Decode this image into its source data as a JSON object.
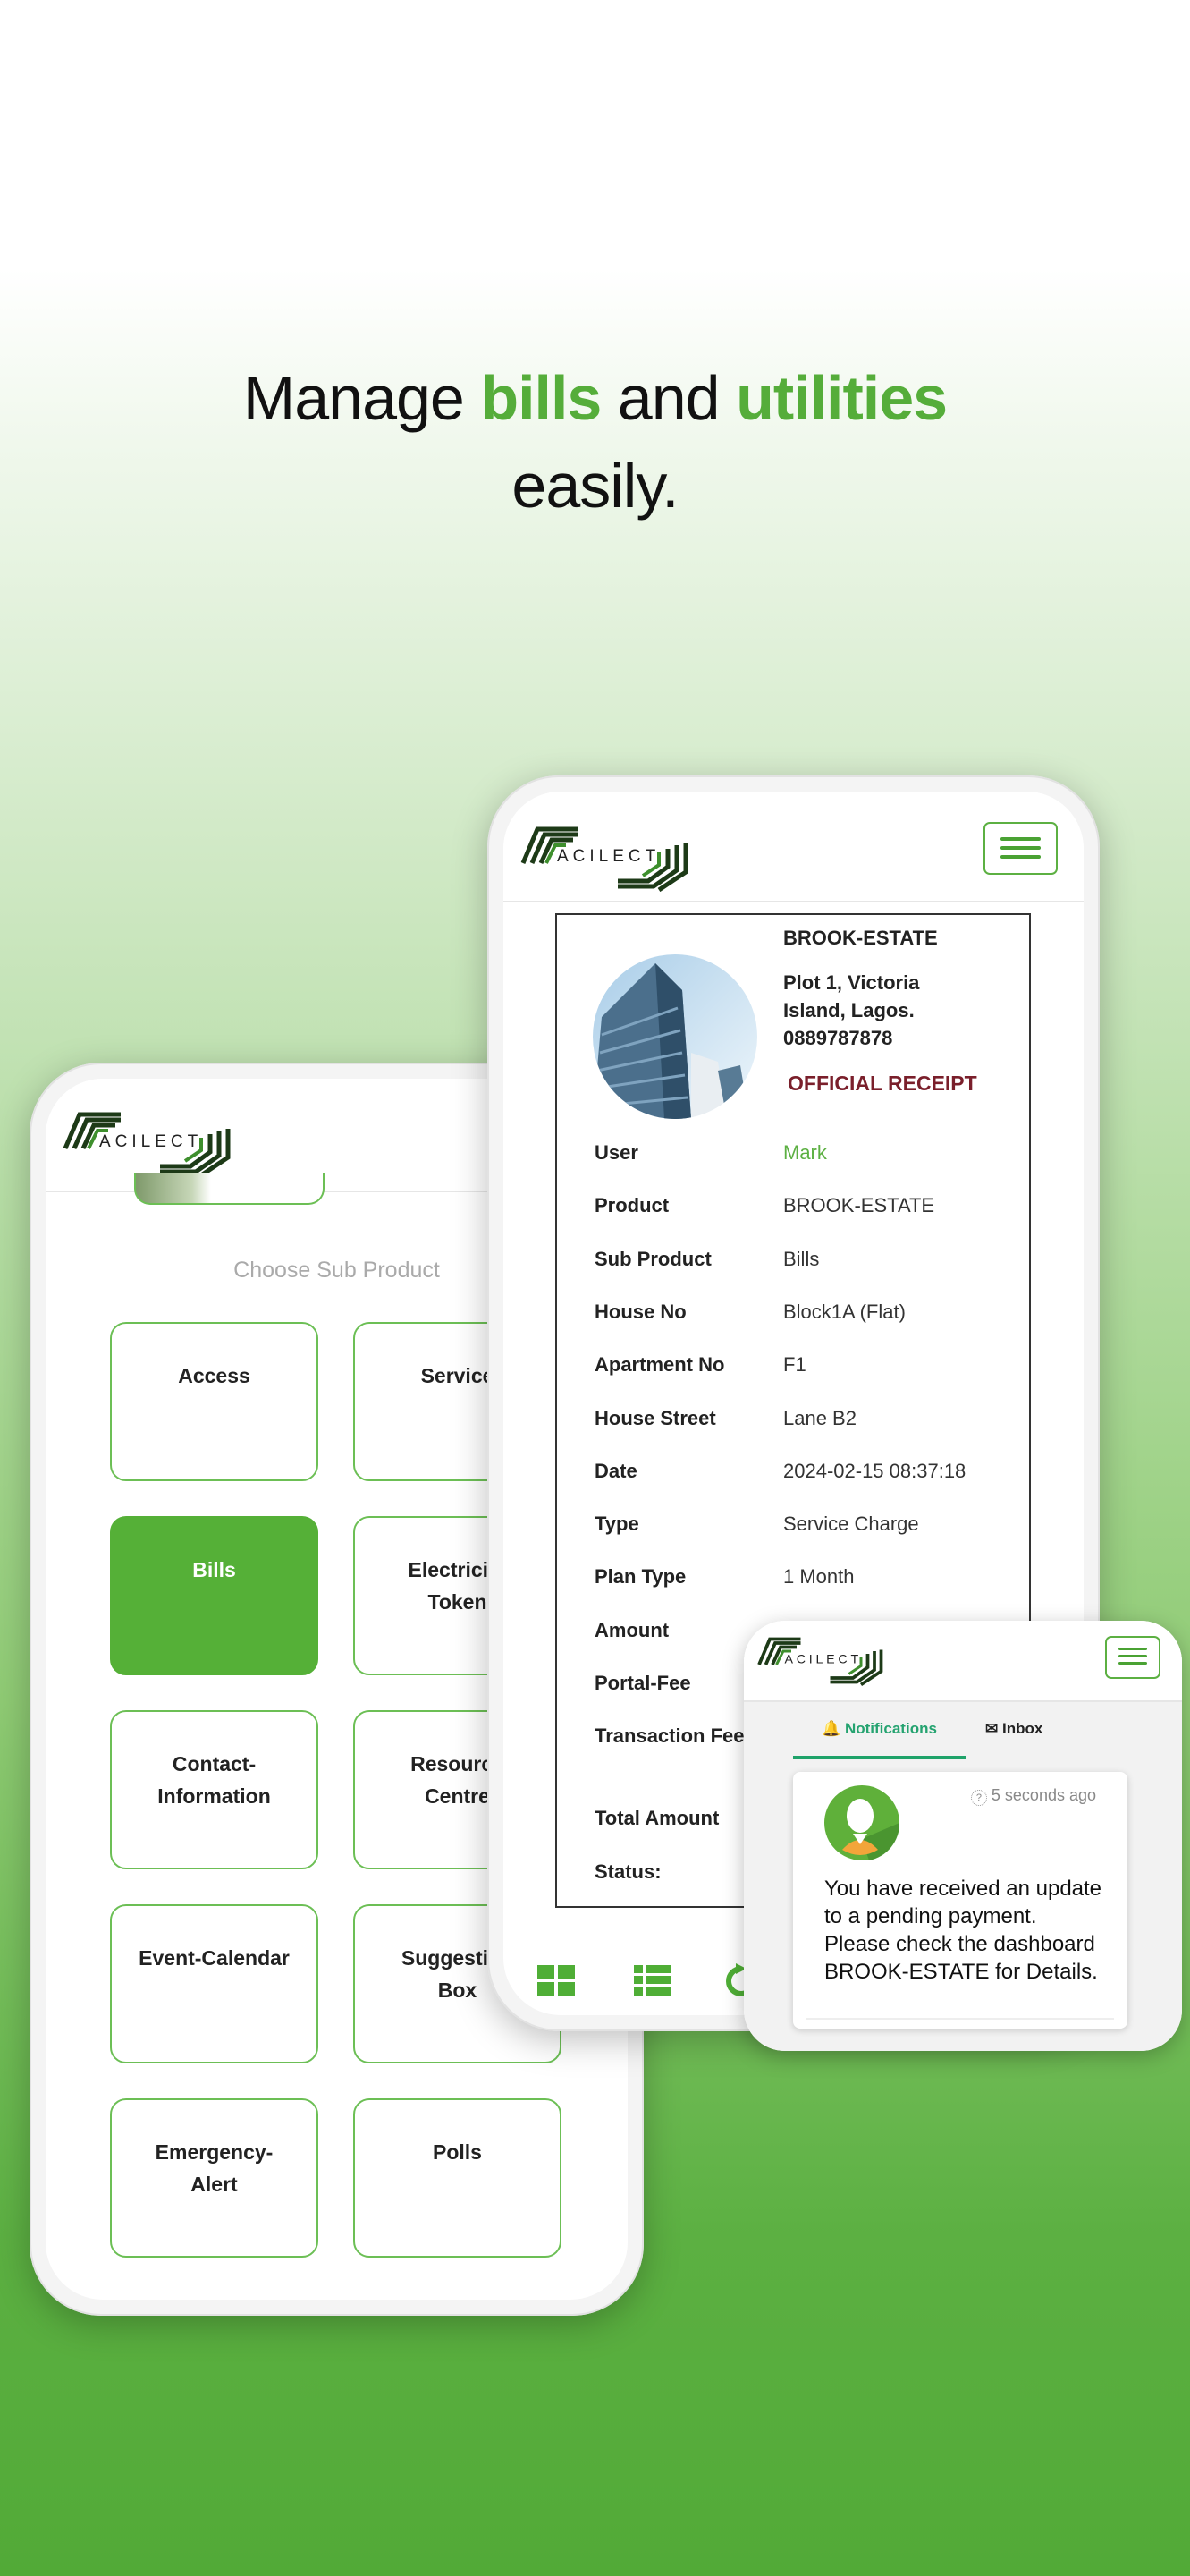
{
  "headline": {
    "part1": "Manage ",
    "highlight1": "bills",
    "part2": " and ",
    "highlight2": "utilities",
    "line2": "easily."
  },
  "brand": {
    "logo_text": "ACILECT",
    "accent_color": "#55ad3a",
    "receipt_title_color": "#7a1f2b"
  },
  "left_phone": {
    "section_title": "Choose Sub Product",
    "tiles": [
      {
        "label": "Access",
        "active": false
      },
      {
        "label": "Service",
        "active": false
      },
      {
        "label": "Bills",
        "active": true
      },
      {
        "label": "Electricity Token",
        "active": false
      },
      {
        "label": "Contact-Information",
        "active": false
      },
      {
        "label": "Resource Centre",
        "active": false
      },
      {
        "label": "Event-Calendar",
        "active": false
      },
      {
        "label": "Suggestion Box",
        "active": false
      },
      {
        "label": "Emergency-Alert",
        "active": false
      },
      {
        "label": "Polls",
        "active": false
      }
    ]
  },
  "receipt": {
    "estate": "BROOK-ESTATE",
    "address1": "Plot 1, Victoria",
    "address2": "Island, Lagos.",
    "phone": "0889787878",
    "title": "OFFICIAL RECEIPT",
    "rows": [
      {
        "label": "User",
        "value": "Mark"
      },
      {
        "label": "Product",
        "value": "BROOK-ESTATE"
      },
      {
        "label": "Sub Product",
        "value": "Bills"
      },
      {
        "label": "House No",
        "value": "Block1A (Flat)"
      },
      {
        "label": "Apartment No",
        "value": "F1"
      },
      {
        "label": "House Street",
        "value": "Lane B2"
      },
      {
        "label": "Date",
        "value": "2024-02-15 08:37:18"
      },
      {
        "label": "Type",
        "value": "Service Charge"
      },
      {
        "label": "Plan Type",
        "value": "1 Month"
      },
      {
        "label": "Amount",
        "value": ""
      },
      {
        "label": "Portal-Fee",
        "value": ""
      },
      {
        "label": "Transaction Fee",
        "value": ""
      },
      {
        "label": "Total Amount",
        "value": ""
      },
      {
        "label": "Status:",
        "value": ""
      }
    ],
    "bottom_nav": [
      "grid-icon",
      "list-icon",
      "refresh-icon"
    ]
  },
  "notifications": {
    "tabs": [
      {
        "label": "Notifications",
        "icon": "bell-icon",
        "active": true
      },
      {
        "label": "Inbox",
        "icon": "envelope-icon",
        "active": false
      }
    ],
    "item": {
      "time": "5 seconds ago",
      "message_lines": [
        "You have received an update",
        "to a pending payment.",
        "Please check the dashboard",
        "BROOK-ESTATE for Details."
      ]
    }
  }
}
